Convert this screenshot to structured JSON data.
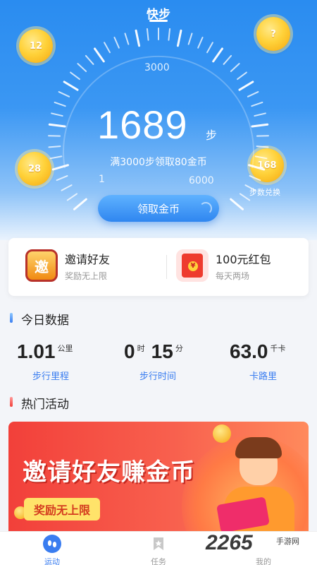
{
  "header": {
    "title": "快步"
  },
  "coins": {
    "left_top": "12",
    "right_top": "?",
    "left_mid": "28",
    "right_mid": "168"
  },
  "gauge": {
    "max_label": "3000",
    "min_label": "1",
    "end_label": "6000"
  },
  "steps": {
    "value": "1689",
    "unit": "步",
    "subtitle": "满3000步领取80金币"
  },
  "exchange_label": "步数兑换",
  "claim_button": "领取金币",
  "promos": [
    {
      "title": "邀请好友",
      "subtitle": "奖励无上限",
      "icon": "invite-icon",
      "icon_char": "邀"
    },
    {
      "title": "100元红包",
      "subtitle": "每天两场",
      "icon": "red-packet-icon"
    }
  ],
  "today": {
    "heading": "今日数据",
    "distance": {
      "value": "1.01",
      "unit": "公里",
      "label": "步行里程"
    },
    "time": {
      "hours": "0",
      "hours_unit": "时",
      "minutes": "15",
      "minutes_unit": "分",
      "label": "步行时间"
    },
    "calories": {
      "value": "63.0",
      "unit": "千卡",
      "label": "卡路里"
    }
  },
  "activities": {
    "heading": "热门活动",
    "banner_title": "邀请好友赚金币",
    "banner_tag": "奖励无上限"
  },
  "tabbar": {
    "items": [
      {
        "label": "运动",
        "icon": "footprints-icon",
        "active": true
      },
      {
        "label": "任务",
        "icon": "bookmark-icon",
        "active": false
      },
      {
        "label": "我的",
        "icon": "profile-icon",
        "active": false
      }
    ]
  },
  "watermark": {
    "brand": "2265",
    "sub": "手游网"
  },
  "colors": {
    "primary": "#2a8cf0",
    "accent": "#3a7df0",
    "coin": "#ffd23a",
    "banner": "#f2403a"
  }
}
